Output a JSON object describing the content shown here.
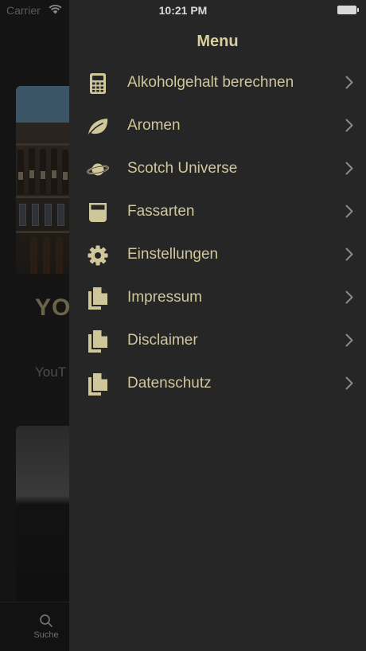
{
  "status_bar": {
    "carrier": "Carrier",
    "time": "10:21 PM"
  },
  "background": {
    "title_fragment": "YO",
    "subtitle_fragment": "YouT",
    "tab_search_label": "Suche"
  },
  "drawer": {
    "title": "Menu",
    "items": [
      {
        "label": "Alkoholgehalt berechnen",
        "icon": "calculator-icon"
      },
      {
        "label": "Aromen",
        "icon": "leaf-icon"
      },
      {
        "label": "Scotch Universe",
        "icon": "planet-icon"
      },
      {
        "label": "Fassarten",
        "icon": "barrel-glass-icon"
      },
      {
        "label": "Einstellungen",
        "icon": "gear-icon"
      },
      {
        "label": "Impressum",
        "icon": "documents-icon"
      },
      {
        "label": "Disclaimer",
        "icon": "documents-icon"
      },
      {
        "label": "Datenschutz",
        "icon": "documents-icon"
      }
    ]
  },
  "colors": {
    "accent": "#d8cfa0",
    "drawer_bg": "#262626",
    "icon_tint": "#cfc79a",
    "chevron": "#8a8a8a"
  }
}
